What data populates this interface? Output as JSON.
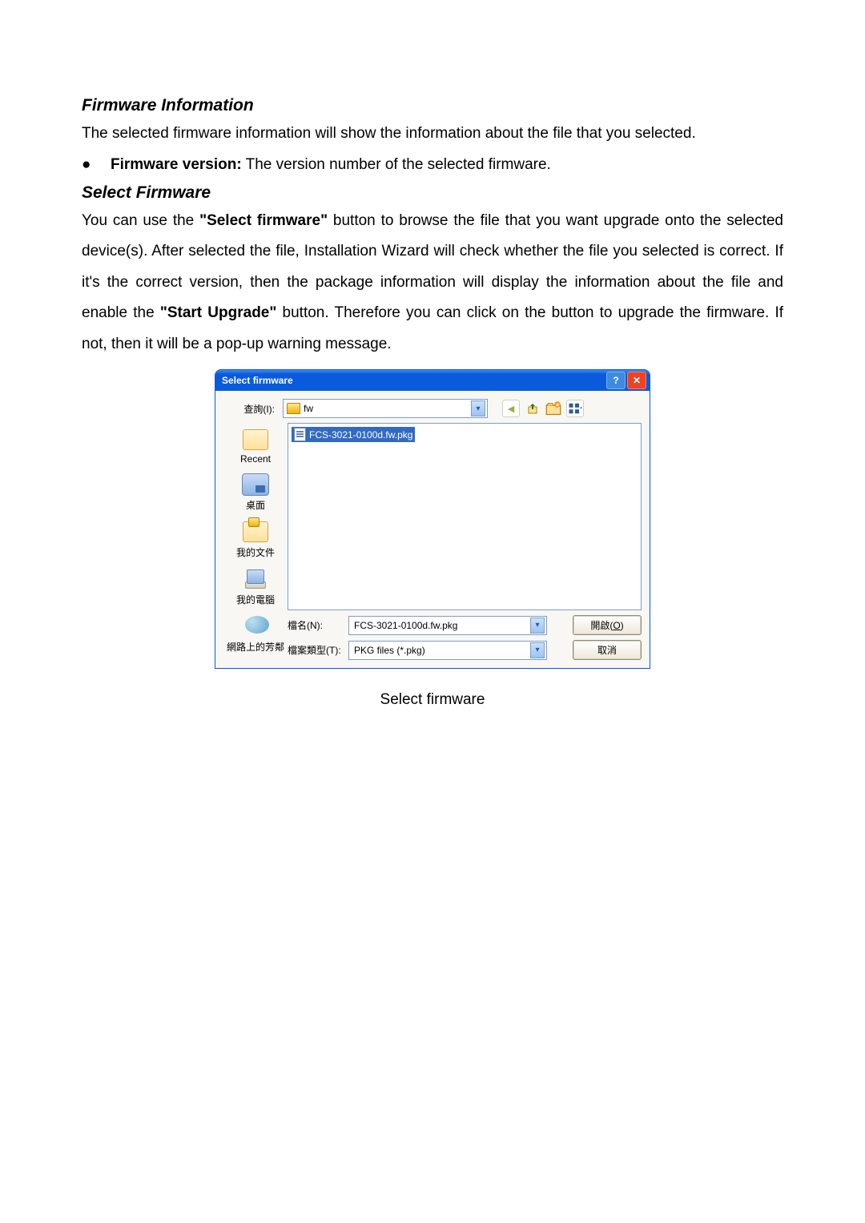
{
  "section1": {
    "heading": "Firmware Information",
    "body": "The selected firmware information will show the information about the file that you selected.",
    "bullet": {
      "label": "Firmware version:",
      "text": " The version number of the selected firmware."
    }
  },
  "section2": {
    "heading": "Select Firmware",
    "body_pre": "You can use the ",
    "body_quote_select": "\"Select firmware\"",
    "body_mid": " button to browse the file that you want upgrade onto the selected device(s). After selected the file, Installation Wizard will check whether the file you selected is correct. If it's the correct version, then the package information will display the information about the file and enable the ",
    "body_quote_start": "\"Start Upgrade\"",
    "body_end": " button. Therefore you can click on the button to upgrade the firmware. If not, then it will be a pop-up warning message."
  },
  "dialog": {
    "title": "Select firmware",
    "lookin_label": "查詢(I):",
    "lookin_value": "fw",
    "places": {
      "recent": "Recent",
      "desktop": "桌面",
      "documents": "我的文件",
      "computer": "我的電腦",
      "network": "網路上的芳鄰"
    },
    "file_selected": "FCS-3021-0100d.fw.pkg",
    "filename_label": "檔名(N):",
    "filename_value": "FCS-3021-0100d.fw.pkg",
    "filetype_label": "檔案類型(T):",
    "filetype_value": "PKG files (*.pkg)",
    "open_btn_pre": "開啟(",
    "open_btn_key": "O",
    "open_btn_post": ")",
    "cancel_btn": "取消"
  },
  "caption": "Select firmware"
}
